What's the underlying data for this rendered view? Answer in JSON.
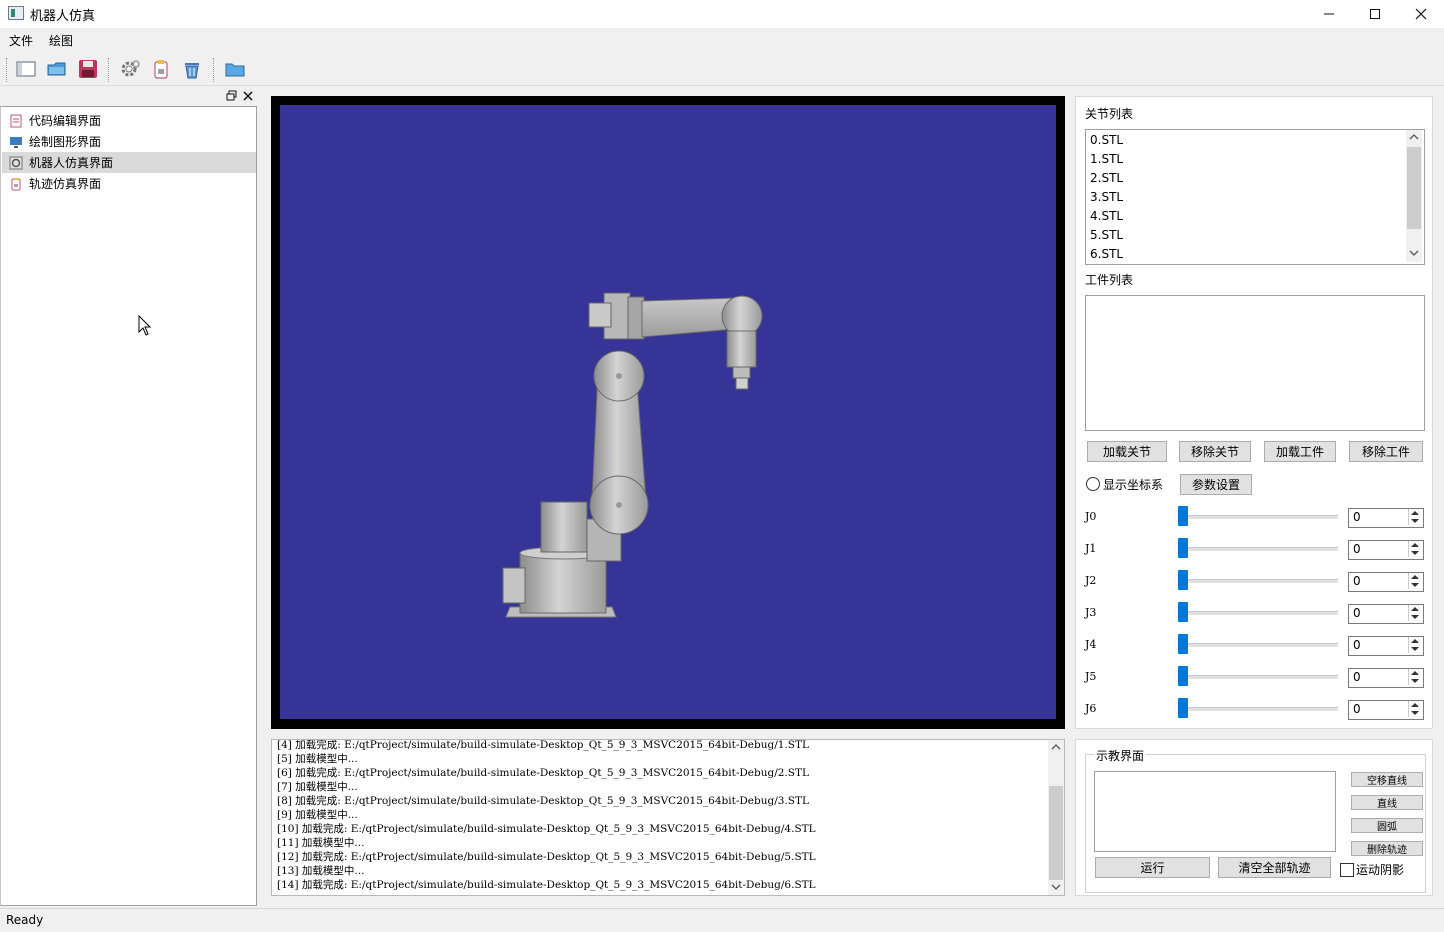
{
  "window": {
    "title": "机器人仿真",
    "controls": [
      "minimize",
      "maximize",
      "close"
    ]
  },
  "menu": [
    "文件",
    "绘图"
  ],
  "toolbar": {
    "buttons": [
      "new-icon",
      "open-folder-icon",
      "save-icon",
      "settings-gear-icon",
      "clipboard-icon",
      "trash-icon",
      "folder-icon"
    ]
  },
  "sidebar": {
    "items": [
      {
        "label": "代码编辑界面",
        "icon": "code-edit-icon",
        "selected": false
      },
      {
        "label": "绘制图形界面",
        "icon": "monitor-icon",
        "selected": false
      },
      {
        "label": "机器人仿真界面",
        "icon": "robot-icon",
        "selected": true
      },
      {
        "label": "轨迹仿真界面",
        "icon": "trajectory-icon",
        "selected": false
      }
    ]
  },
  "viewport": {
    "background": "#363597"
  },
  "log": {
    "lines": [
      "[4] 加载完成: E:/qtProject/simulate/build-simulate-Desktop_Qt_5_9_3_MSVC2015_64bit-Debug/1.STL",
      "[5] 加载模型中...",
      "[6] 加载完成: E:/qtProject/simulate/build-simulate-Desktop_Qt_5_9_3_MSVC2015_64bit-Debug/2.STL",
      "[7] 加载模型中...",
      "[8] 加载完成: E:/qtProject/simulate/build-simulate-Desktop_Qt_5_9_3_MSVC2015_64bit-Debug/3.STL",
      "[9] 加载模型中...",
      "[10] 加载完成: E:/qtProject/simulate/build-simulate-Desktop_Qt_5_9_3_MSVC2015_64bit-Debug/4.STL",
      "[11] 加载模型中...",
      "[12] 加载完成: E:/qtProject/simulate/build-simulate-Desktop_Qt_5_9_3_MSVC2015_64bit-Debug/5.STL",
      "[13] 加载模型中...",
      "[14] 加载完成: E:/qtProject/simulate/build-simulate-Desktop_Qt_5_9_3_MSVC2015_64bit-Debug/6.STL"
    ]
  },
  "joints_panel": {
    "joint_list_label": "关节列表",
    "joint_list": [
      "0.STL",
      "1.STL",
      "2.STL",
      "3.STL",
      "4.STL",
      "5.STL",
      "6.STL"
    ],
    "workpiece_list_label": "工件列表",
    "workpiece_list": [],
    "buttons": {
      "load_joint": "加载关节",
      "remove_joint": "移除关节",
      "load_workpiece": "加载工件",
      "remove_workpiece": "移除工件"
    },
    "show_axes_label": "显示坐标系",
    "show_axes_checked": false,
    "param_settings": "参数设置",
    "joints": [
      {
        "name": "J0",
        "value": "0"
      },
      {
        "name": "J1",
        "value": "0"
      },
      {
        "name": "J2",
        "value": "0"
      },
      {
        "name": "J3",
        "value": "0"
      },
      {
        "name": "J4",
        "value": "0"
      },
      {
        "name": "J5",
        "value": "0"
      },
      {
        "name": "J6",
        "value": "0"
      }
    ]
  },
  "teach_panel": {
    "title": "示教界面",
    "side_buttons": [
      "空移直线",
      "直线",
      "圆弧",
      "删除轨迹"
    ],
    "run": "运行",
    "clear_all": "清空全部轨迹",
    "motion_shadow_label": "运动阴影",
    "motion_shadow_checked": false
  },
  "status": {
    "text": "Ready"
  }
}
